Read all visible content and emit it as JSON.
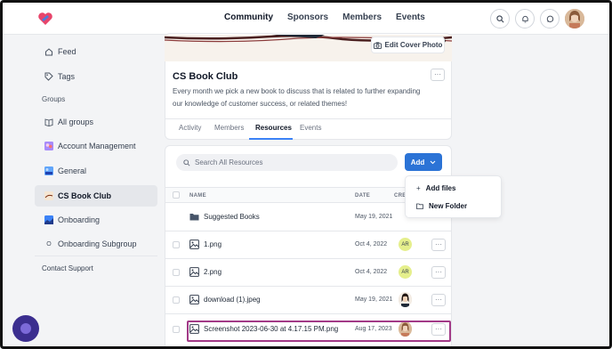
{
  "nav": {
    "links": [
      "Community",
      "Sponsors",
      "Members",
      "Events"
    ],
    "active": "Community"
  },
  "sidebar": {
    "feed": "Feed",
    "tags": "Tags",
    "groups_heading": "Groups",
    "items": [
      {
        "label": "All groups",
        "icon": "book-icon"
      },
      {
        "label": "Account Management",
        "icon": "group-thumbnail"
      },
      {
        "label": "General",
        "icon": "group-thumbnail"
      },
      {
        "label": "CS Book Club",
        "icon": "group-thumbnail"
      },
      {
        "label": "Onboarding",
        "icon": "group-thumbnail"
      },
      {
        "label": "Onboarding Subgroup",
        "icon": "group-letter-o"
      }
    ],
    "group_letter": "O",
    "active": "CS Book Club",
    "contact_support": "Contact Support"
  },
  "group": {
    "edit_cover": "Edit Cover Photo",
    "title": "CS Book Club",
    "description": "Every month we pick a new book to discuss that is related to further expanding our knowledge of customer success, or related themes!",
    "tabs": [
      "Activity",
      "Members",
      "Resources",
      "Events"
    ],
    "active_tab": "Resources"
  },
  "resources": {
    "search_placeholder": "Search All Resources",
    "add_label": "Add",
    "dropdown": {
      "add_files": "Add files",
      "new_folder": "New Folder"
    },
    "columns": {
      "name": "NAME",
      "date": "DATE",
      "creator": "CRE..."
    },
    "rows": [
      {
        "name": "Suggested Books",
        "type": "folder",
        "date": "May 19, 2021",
        "creator": ""
      },
      {
        "name": "1.png",
        "type": "image",
        "date": "Oct 4, 2022",
        "creator": "AR"
      },
      {
        "name": "2.png",
        "type": "image",
        "date": "Oct 4, 2022",
        "creator": "AR"
      },
      {
        "name": "download (1).jpeg",
        "type": "image",
        "date": "May 19, 2021",
        "creator": "photo"
      },
      {
        "name": "Screenshot 2023-06-30 at 4.17.15 PM.png",
        "type": "image",
        "date": "Aug 17, 2023",
        "creator": "photo"
      }
    ],
    "more_icon": "···"
  },
  "colors": {
    "accent": "#2b73d6",
    "highlight": "#a23a87",
    "badge": "#e5ef8c"
  }
}
